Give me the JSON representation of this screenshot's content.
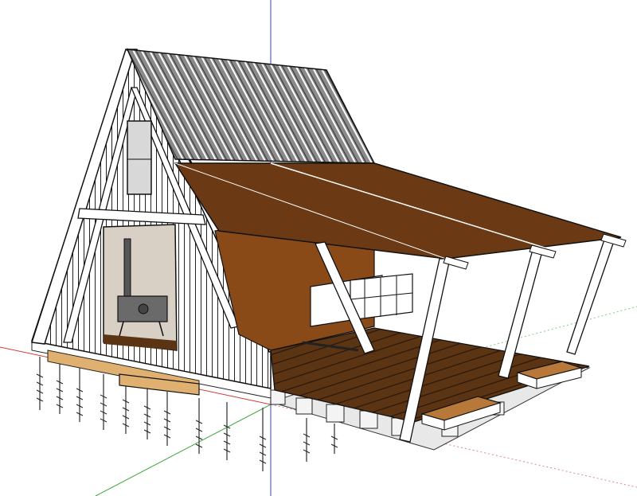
{
  "viewport": {
    "background": "#ffffff",
    "axis_colors": {
      "blue": "#3a3ad8",
      "red": "#d83a3a",
      "green": "#3aa83a"
    }
  },
  "model": {
    "roof_color": "#7a7a7a",
    "siding_color": "#ffffff",
    "frame_color": "#ffffff",
    "canopy_color": "#6b3a14",
    "deck_color": "#5b3414",
    "interior_wall_color": "#8a4a18",
    "outline_color": "#111111",
    "stove_color": "#6a6a6a",
    "bench_color": "#b8783a",
    "pile_color": "#888888"
  }
}
